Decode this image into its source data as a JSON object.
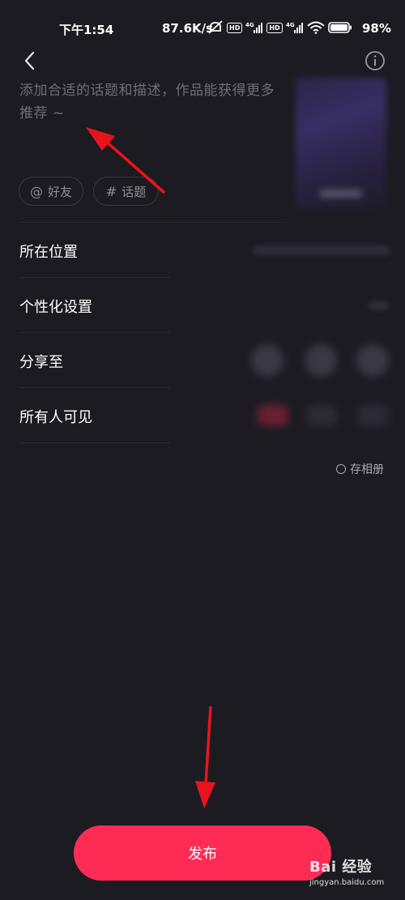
{
  "status_bar": {
    "time": "下午1:54",
    "network_speed": "87.6K/s",
    "battery": "98%",
    "icons": [
      "mute-icon",
      "hd-icon",
      "signal-4g-icon",
      "hd-icon",
      "signal-4g-icon",
      "wifi-icon",
      "battery-icon"
    ]
  },
  "description": {
    "placeholder": "添加合适的话题和描述，作品能获得更多推荐 ~"
  },
  "chips": [
    {
      "symbol": "@",
      "label": "好友"
    },
    {
      "symbol": "#",
      "label": "话题"
    }
  ],
  "settings": [
    {
      "label": "所在位置"
    },
    {
      "label": "个性化设置"
    },
    {
      "label": "分享至"
    },
    {
      "label": "所有人可见"
    }
  ],
  "save_album": {
    "label": "存相册",
    "checked": false
  },
  "publish": {
    "label": "发布"
  },
  "watermark": {
    "main": "Bai 经验",
    "sub": "jingyan.baidu.com"
  },
  "colors": {
    "background": "#1c1b22",
    "accent": "#fe2c55",
    "annotation_arrow": "#e8141c"
  }
}
